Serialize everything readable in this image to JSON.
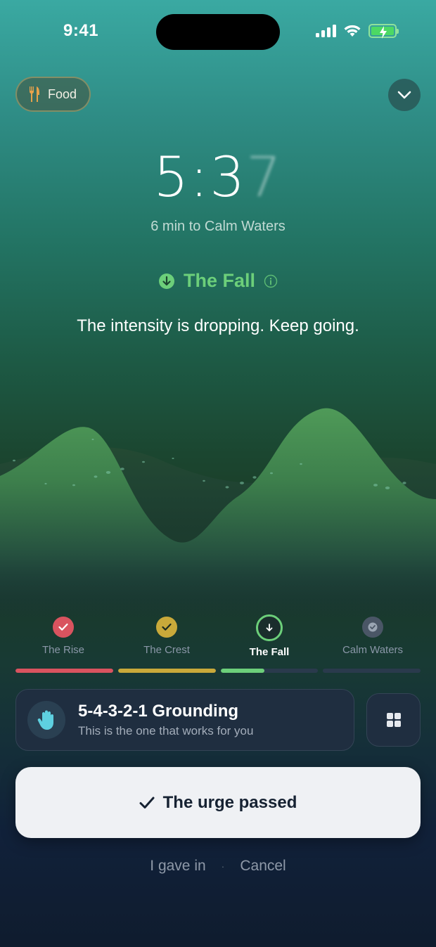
{
  "status_bar": {
    "time": "9:41"
  },
  "category": {
    "label": "Food",
    "icon": "fork-knife-icon"
  },
  "timer": {
    "minutes": "5",
    "separator": ":",
    "tens": "3",
    "ones": "7"
  },
  "time_to_calm": "6 min to Calm Waters",
  "current_phase": {
    "title": "The Fall",
    "icon": "arrow-down-circle-icon"
  },
  "phase_message": "The intensity is dropping. Keep going.",
  "phases": [
    {
      "label": "The Rise",
      "state": "done",
      "color": "#d9535f"
    },
    {
      "label": "The Crest",
      "state": "done",
      "color": "#c9a93a"
    },
    {
      "label": "The Fall",
      "state": "active",
      "color": "#6ccf7a"
    },
    {
      "label": "Calm Waters",
      "state": "upcoming",
      "color": "#5f6b7a"
    }
  ],
  "progress": [
    1,
    1,
    0.45,
    0
  ],
  "technique": {
    "title": "5-4-3-2-1 Grounding",
    "subtitle": "This is the one that works for you",
    "icon": "hand-icon"
  },
  "actions": {
    "primary": "The urge passed",
    "gave_in": "I gave in",
    "separator": "·",
    "cancel": "Cancel"
  },
  "colors": {
    "accent_green": "#6ccf7a",
    "background": "#0f1c2e",
    "rise_red": "#d9535f",
    "crest_gold": "#c9a93a"
  }
}
